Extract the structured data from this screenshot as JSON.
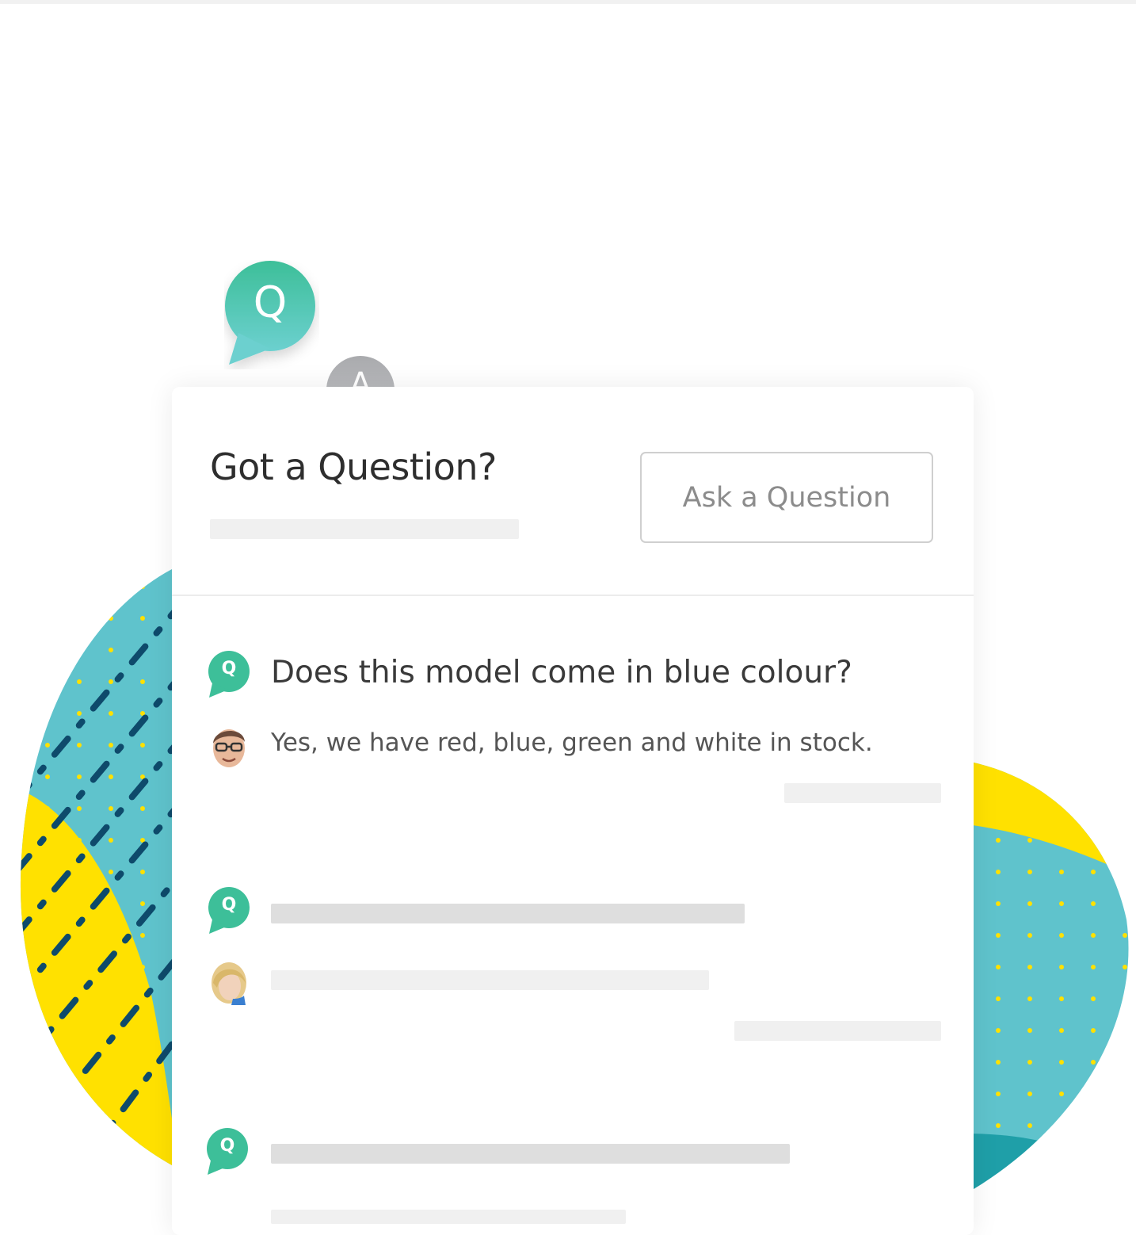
{
  "widget": {
    "title": "Got a Question?",
    "ask_button_label": "Ask a Question",
    "badge_question_letter": "Q",
    "badge_answer_letter": "A"
  },
  "thread": {
    "question": "Does this model come in blue colour?",
    "answer": "Yes, we have red, blue, green and white in stock.",
    "question_icon_letter": "Q"
  },
  "colors": {
    "accent_green": "#3dbf99",
    "teal": "#5fc3cc",
    "yellow": "#ffe100",
    "navy_dashes": "#0e4a6b",
    "placeholder_light": "#f0f0f0",
    "placeholder_dark": "#dedede"
  },
  "icons": [
    "question-bubble-icon",
    "answer-bubble-icon",
    "male-avatar",
    "female-avatar"
  ]
}
